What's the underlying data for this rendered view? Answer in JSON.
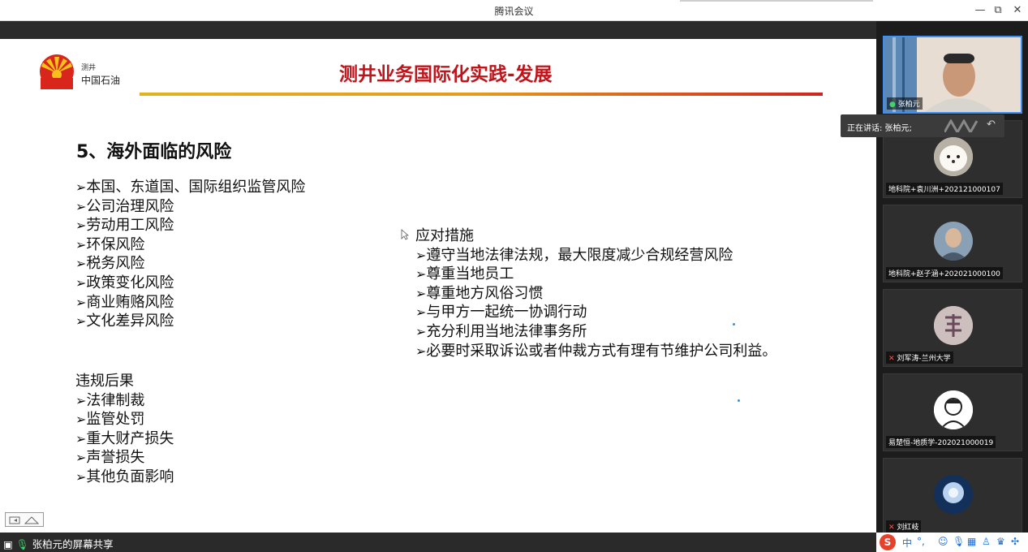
{
  "window": {
    "title": "腾讯会议",
    "controls": {
      "minimize": "—",
      "restore": "⧉",
      "close": "✕"
    }
  },
  "slide": {
    "logo_small_text": "测井",
    "logo_text": "中国石油",
    "title": "测井业务国际化实践-发展",
    "heading": "5、海外面临的风险",
    "bullet": "➢",
    "risks": [
      "本国、东道国、国际组织监管风险",
      "公司治理风险",
      "劳动用工风险",
      "环保风险",
      "税务风险",
      "政策变化风险",
      "商业贿赂风险",
      "文化差异风险"
    ],
    "consequences_heading": "违规后果",
    "consequences": [
      "法律制裁",
      "监管处罚",
      "重大财产损失",
      "声誉损失",
      "其他负面影响"
    ],
    "measures_heading": "应对措施",
    "measures": [
      "遵守当地法律法规，最大限度减少合规经营风险",
      "尊重当地员工",
      "尊重地方风俗习惯",
      "与甲方一起统一协调行动",
      "充分利用当地法律事务所",
      "必要时采取诉讼或者仲裁方式有理有节维护公司利益。"
    ]
  },
  "bottom_bar": {
    "share_label": "张柏元的屏幕共享"
  },
  "speaking_indicator": {
    "text": "正在讲话: 张柏元;"
  },
  "participants": [
    {
      "name": "张柏元"
    },
    {
      "name": "地科院+袁川洲+202121000107"
    },
    {
      "name": "地科院+赵子涵+202021000100"
    },
    {
      "name": "刘军涛-兰州大学"
    },
    {
      "name": "易楚恒-地质学-202021000019"
    },
    {
      "name": "刘红岐"
    }
  ],
  "ime": {
    "mode": "中",
    "punct": "°,"
  },
  "colors": {
    "title_red": "#c0141a",
    "accent_blue": "#3f8ef2"
  }
}
